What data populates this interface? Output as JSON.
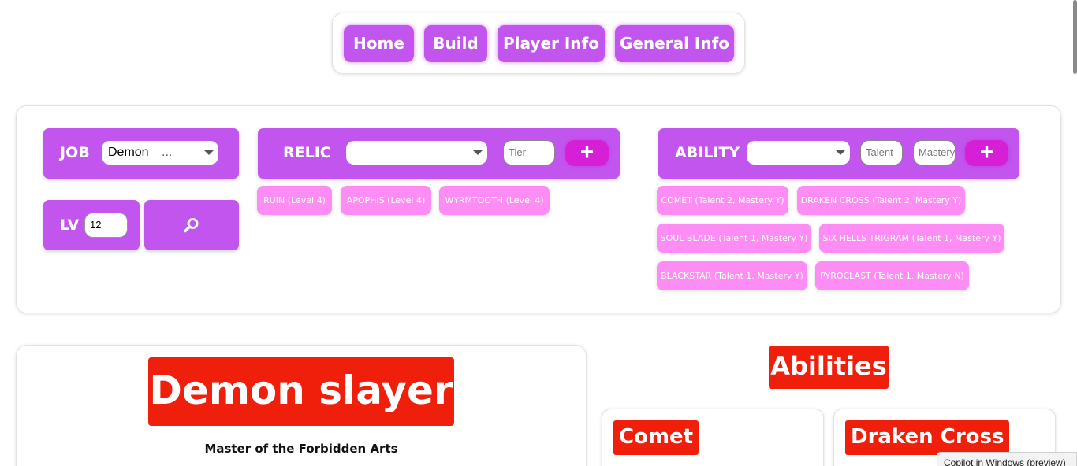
{
  "nav": {
    "items": [
      {
        "label": "Home"
      },
      {
        "label": "Build"
      },
      {
        "label": "Player Info"
      },
      {
        "label": "General Info"
      }
    ]
  },
  "form": {
    "job_label": "JOB",
    "job_value": "Demon",
    "job_truncation": "...",
    "lv_label": "LV",
    "lv_value": "12",
    "relic_label": "RELIC",
    "relic_value": "",
    "tier_placeholder": "Tier",
    "ability_label": "ABILITY",
    "ability_value": "",
    "talent_placeholder": "Talent",
    "mastery_placeholder": "Mastery",
    "plus_symbol": "+",
    "search_icon": "magnifier",
    "relics": [
      "RUIN (Level 4)",
      "APOPHIS (Level 4)",
      "WYRMTOOTH (Level 4)"
    ],
    "abilities": [
      "COMET (Talent 2, Mastery Y)",
      "DRAKEN CROSS (Talent 2, Mastery Y)",
      "SOUL BLADE (Talent 1, Mastery Y)",
      "SIX HELLS TRIGRAM (Talent 1, Mastery Y)",
      "BLACKSTAR (Talent 1, Mastery Y)",
      "PYROCLAST (Talent 1, Mastery N)"
    ]
  },
  "class_card": {
    "title": "Demon slayer",
    "subtitle": "Master of the Forbidden Arts"
  },
  "abilities_section": {
    "heading": "Abilities",
    "cards": [
      {
        "title": "Comet"
      },
      {
        "title": "Draken Cross"
      }
    ]
  },
  "overlay": {
    "copilot": "Copilot in Windows (preview)"
  },
  "colors": {
    "primary_purple": "#c255ee",
    "chip_pink": "#fd8cf5",
    "plus_magenta": "#d61fd6",
    "title_red": "#ef1f0c"
  }
}
